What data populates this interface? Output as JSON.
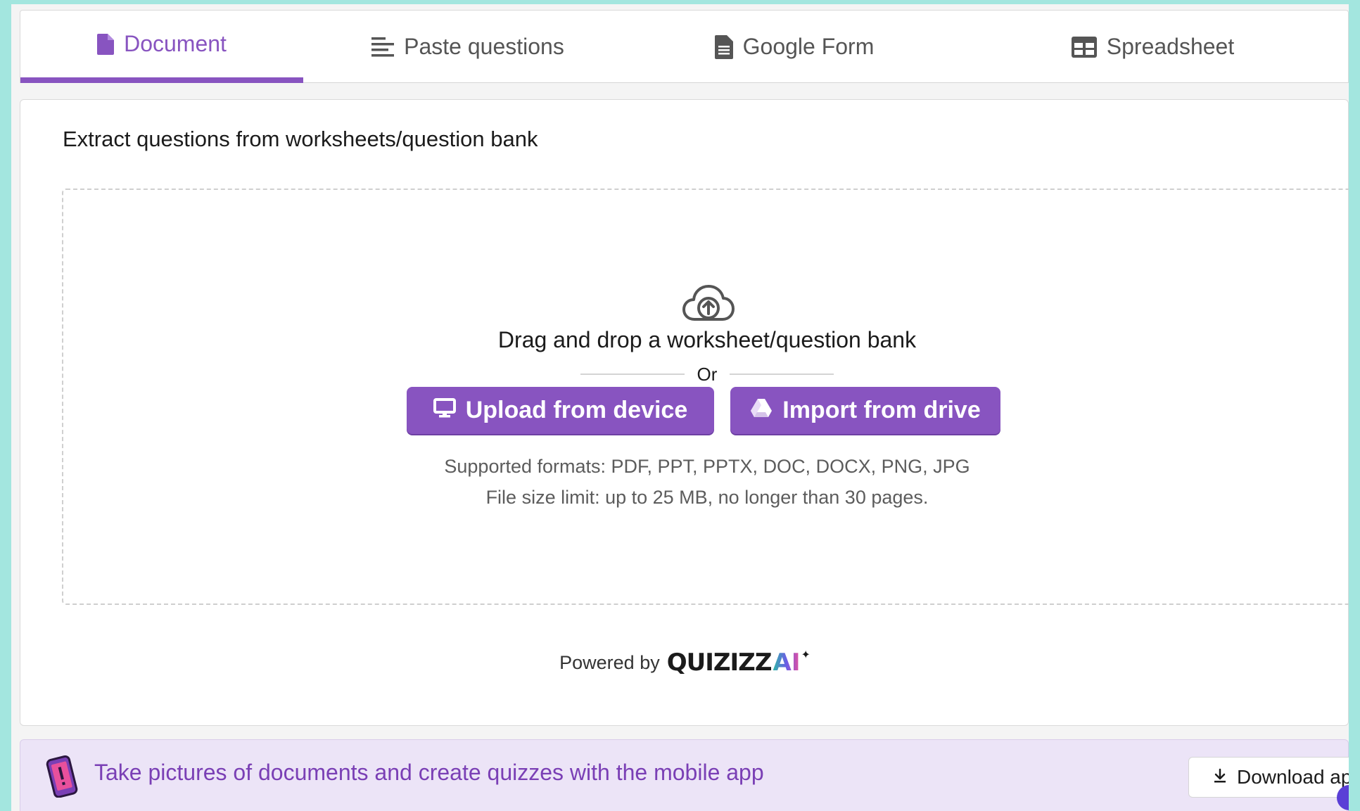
{
  "tabs": [
    {
      "label": "Document",
      "icon": "document-icon",
      "active": true
    },
    {
      "label": "Paste questions",
      "icon": "text-lines-icon",
      "active": false
    },
    {
      "label": "Google Form",
      "icon": "form-file-icon",
      "active": false
    },
    {
      "label": "Spreadsheet",
      "icon": "table-icon",
      "active": false
    }
  ],
  "main": {
    "heading": "Extract questions from worksheets/question bank",
    "dropzone": {
      "icon": "cloud-upload-icon",
      "drag_text": "Drag and drop a worksheet/question bank",
      "or_text": "Or",
      "upload_button": "Upload from device",
      "drive_button": "Import from drive",
      "formats_text": "Supported formats: PDF, PPT, PPTX, DOC, DOCX, PNG, JPG",
      "limit_text": "File size limit: up to 25 MB, no longer than 30 pages."
    },
    "powered_by": "Powered by",
    "brand": "QUIZIZZ",
    "brand_ai": "AI"
  },
  "banner": {
    "text": "Take pictures of documents and create quizzes with the mobile app",
    "download_button": "Download app"
  },
  "colors": {
    "accent": "#8854c0",
    "banner_bg": "#ece4f7",
    "page_bg": "#a3e6df"
  }
}
